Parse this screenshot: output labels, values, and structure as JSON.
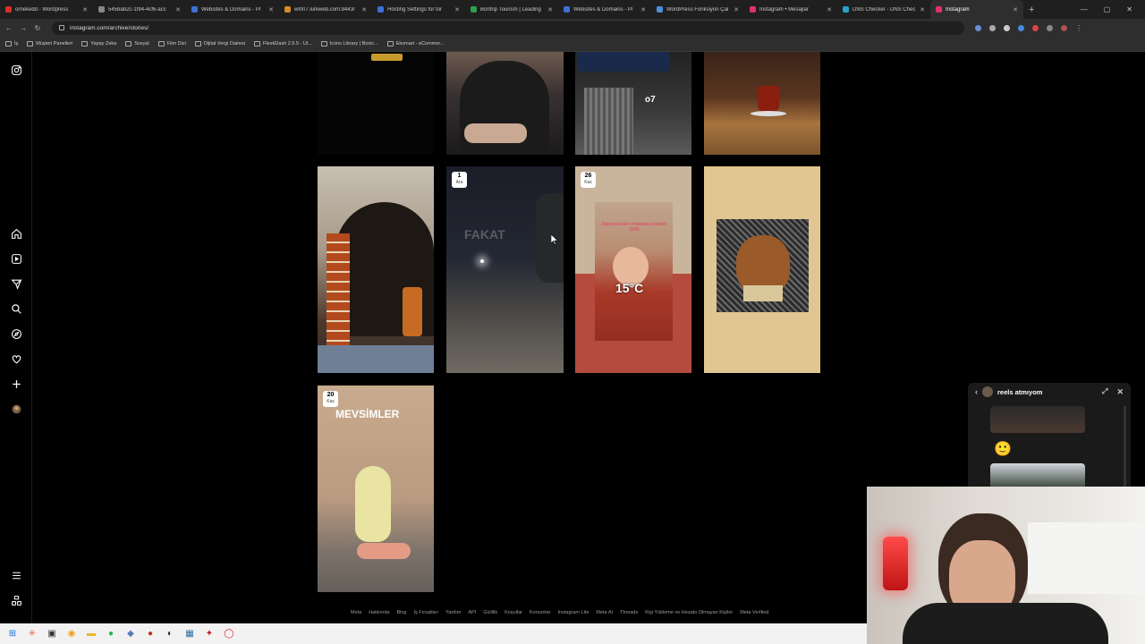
{
  "browser": {
    "tabs": [
      {
        "label": "ornekedd - Wordpress",
        "color": "#d93025"
      },
      {
        "label": "545bab2c-1f94-4cf6-acc",
        "color": "#888888"
      },
      {
        "label": "Websites & Domains - Pl",
        "color": "#3d6fd6"
      },
      {
        "label": "wl007.lurkweb.com:8443/",
        "color": "#d98a25"
      },
      {
        "label": "Hosting Settings for tor",
        "color": "#3d6fd6"
      },
      {
        "label": "Bontrip Tourism | Leading",
        "color": "#2e9e50"
      },
      {
        "label": "Websites & Domains - Pl",
        "color": "#3d6fd6"
      },
      {
        "label": "WordPress Fonksiyon Çal",
        "color": "#4a90d9"
      },
      {
        "label": "Instagram • Mesajlar",
        "color": "#e1306c"
      },
      {
        "label": "DNS Checker - DNS Chec",
        "color": "#2aa0c8"
      },
      {
        "label": "Instagram",
        "color": "#e1306c"
      }
    ],
    "url": "instagram.com/archive/stories/",
    "bookmarks": [
      "İş",
      "Müşteri Panelleri",
      "Yapay Zeka",
      "Sosyal",
      "Film Dizi",
      "Dijital Vergi Dairesi",
      "FleekDash 2.5.5 - Ul...",
      "Icons Library | Boxic...",
      "Ekomart - eCommer..."
    ]
  },
  "sidebar": {
    "items": [
      "instagram-logo-icon",
      "home-icon",
      "reels-icon",
      "send-icon",
      "search-icon",
      "explore-icon",
      "heart-icon",
      "create-icon",
      "avatar",
      "menu-icon",
      "threads-icon"
    ]
  },
  "stories": {
    "tiles": [
      {
        "badge_day": "1",
        "badge_month": "Ara",
        "overlay": "FAKAT"
      },
      {
        "badge_day": "26",
        "badge_month": "Kas",
        "overlay": "15°C",
        "caption": "Japonya'daki ortalama sıcaklık: 1940"
      },
      {
        "badge_day": "20",
        "badge_month": "Kas",
        "overlay": "MEVSİMLER"
      }
    ],
    "o7_text": "o7"
  },
  "footer": {
    "links": [
      "Meta",
      "Hakkında",
      "Blog",
      "İş Fırsatları",
      "Yardım",
      "API",
      "Gizlilik",
      "Koşullar",
      "Konumlar",
      "Instagram Lite",
      "Meta AI",
      "Threads",
      "Kişi Yükleme ve Hesabı Olmayan Kişiler",
      "Meta Verified"
    ]
  },
  "messages_popup": {
    "title": "reels atmıyom",
    "emoji": "🙂"
  },
  "colors": {
    "background": "#000000",
    "accent": "#e1306c"
  }
}
